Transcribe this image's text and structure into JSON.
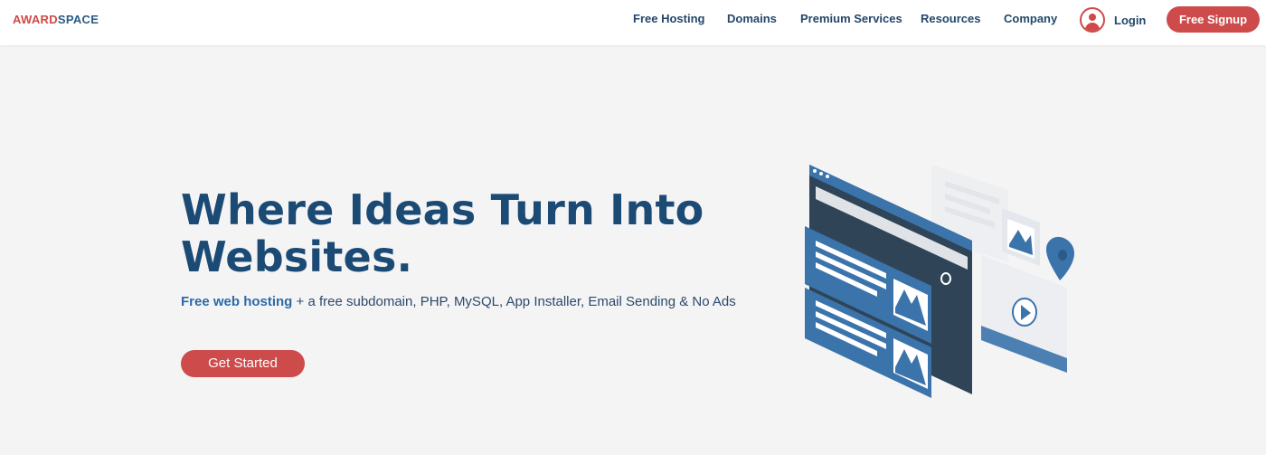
{
  "header": {
    "logo": {
      "part1": "AWARD",
      "part2": "SPACE"
    },
    "nav": [
      {
        "label": "Free Hosting",
        "name": "nav-free-hosting"
      },
      {
        "label": "Domains",
        "name": "nav-domains"
      },
      {
        "label": "Premium Services",
        "name": "nav-premium-services"
      },
      {
        "label": "Resources",
        "name": "nav-resources"
      },
      {
        "label": "Company",
        "name": "nav-company"
      }
    ],
    "login_label": "Login",
    "signup_label": "Free Signup",
    "icons": {
      "login": "user-circle-icon"
    }
  },
  "hero": {
    "title": "Where Ideas Turn Into Websites.",
    "subtitle_highlight": "Free web hosting",
    "subtitle_rest": " + a free subdomain, PHP, MySQL, App Installer, Email Sending & No Ads",
    "cta_label": "Get Started",
    "illustration_icon": "browser-windows-illustration"
  },
  "colors": {
    "brand_red": "#cd4b4b",
    "brand_blue": "#1b4a74",
    "accent_blue": "#3b73ab",
    "background": "#f4f4f5"
  }
}
